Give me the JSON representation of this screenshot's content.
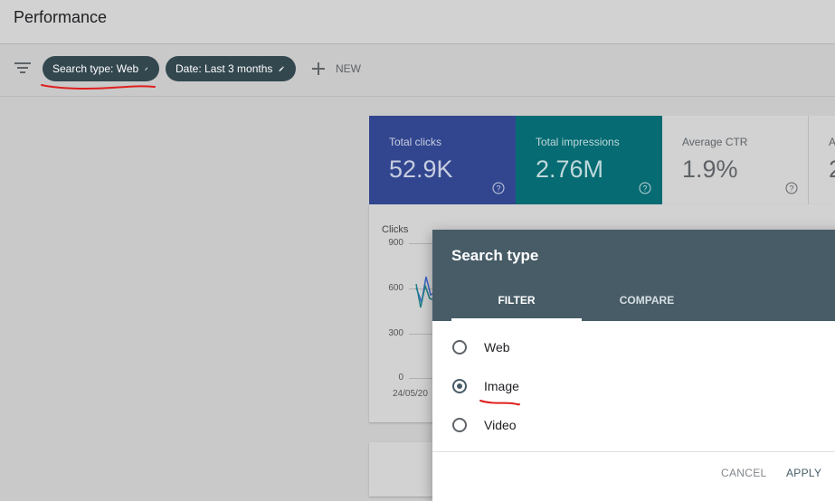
{
  "page": {
    "title": "Performance"
  },
  "filters": {
    "search_type_chip": "Search type: Web",
    "date_chip": "Date: Last 3 months",
    "new_label": "NEW"
  },
  "metrics": {
    "clicks": {
      "label": "Total clicks",
      "value": "52.9K"
    },
    "impressions": {
      "label": "Total impressions",
      "value": "2.76M"
    },
    "ctr": {
      "label": "Average CTR",
      "value": "1.9%"
    },
    "position": {
      "label": "A",
      "value": "2"
    }
  },
  "chart": {
    "y_title": "Clicks",
    "y_ticks": [
      "900",
      "600",
      "300",
      "0"
    ],
    "x_tick": "24/05/20",
    "series_colors": [
      "#3a64c8",
      "#1e7f86"
    ]
  },
  "dialog": {
    "title": "Search type",
    "tabs": [
      "FILTER",
      "COMPARE"
    ],
    "active_tab": "FILTER",
    "options": [
      "Web",
      "Image",
      "Video"
    ],
    "selected": "Image",
    "cancel_label": "CANCEL",
    "apply_label": "APPLY"
  },
  "annotations": {
    "color": "#e0201f"
  }
}
